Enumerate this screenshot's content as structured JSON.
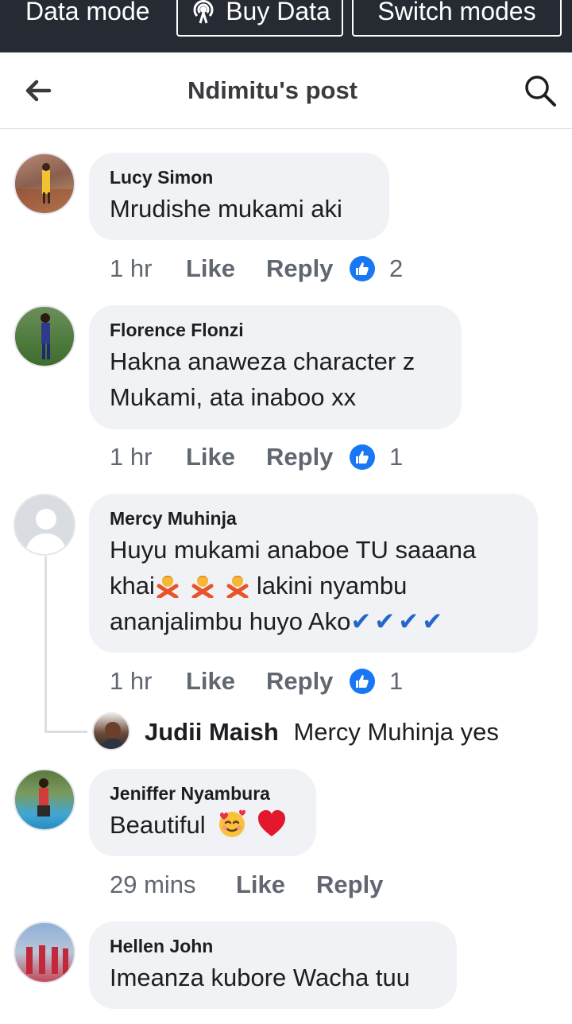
{
  "topbar": {
    "mode_label": "Data mode",
    "buy_label": "Buy Data",
    "switch_label": "Switch modes"
  },
  "header": {
    "title": "Ndimitu's post"
  },
  "comments": [
    {
      "author": "Lucy Simon",
      "text": "Mrudishe mukami aki",
      "time": "1 hr",
      "like_label": "Like",
      "reply_label": "Reply",
      "reactions": "2"
    },
    {
      "author": "Florence Flonzi",
      "text_line1": "Hakna anaweza character z",
      "text_line2": "Mukami, ata inaboo xx",
      "time": "1 hr",
      "like_label": "Like",
      "reply_label": "Reply",
      "reactions": "1"
    },
    {
      "author": "Mercy Muhinja",
      "text_line1": "Huyu mukami anaboe TU saaana",
      "text_line2_a": "khai",
      "text_line2_b": "lakini nyambu",
      "text_line3": "ananjalimbu huyo Ako",
      "text_line3_checks": "✔✔✔✔",
      "time": "1 hr",
      "like_label": "Like",
      "reply_label": "Reply",
      "reactions": "1",
      "reply": {
        "author": "Judii Maish",
        "text": "Mercy Muhinja yes"
      }
    },
    {
      "author": "Jeniffer Nyambura",
      "text": "Beautiful",
      "time": "29 mins",
      "like_label": "Like",
      "reply_label": "Reply"
    },
    {
      "author": "Hellen John",
      "text": "Imeanza kubore Wacha tuu"
    }
  ],
  "colors": {
    "topbar_bg": "#252a33",
    "bubble_bg": "#f0f2f5",
    "like_blue": "#1877f2",
    "meta_gray": "#606770"
  }
}
